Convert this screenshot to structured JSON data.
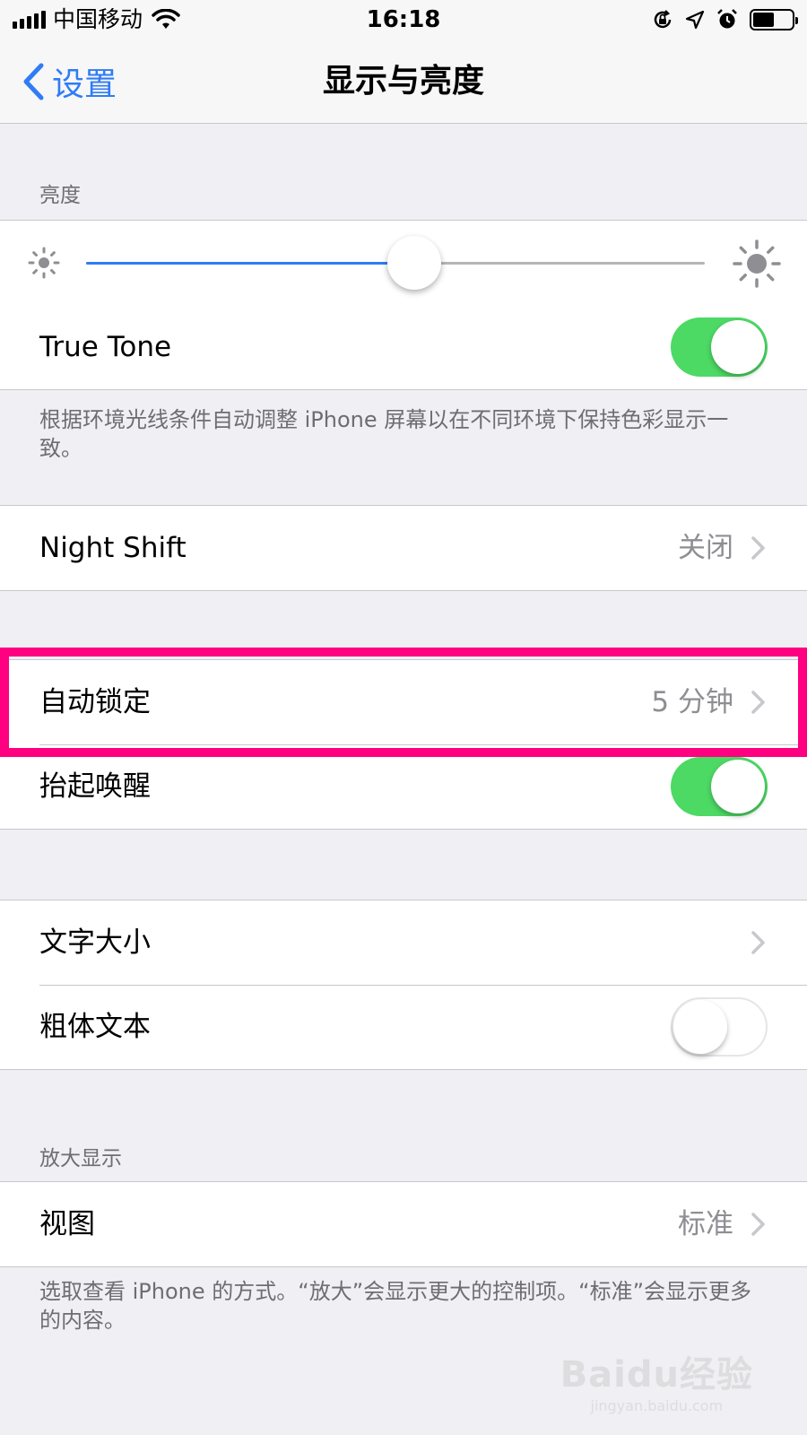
{
  "status_bar": {
    "carrier": "中国移动",
    "time": "16:18"
  },
  "nav": {
    "back_label": "设置",
    "title": "显示与亮度"
  },
  "brightness": {
    "header": "亮度",
    "level_percent": 53
  },
  "true_tone": {
    "label": "True Tone",
    "enabled": true,
    "footer": "根据环境光线条件自动调整 iPhone 屏幕以在不同环境下保持色彩显示一致。"
  },
  "night_shift": {
    "label": "Night Shift",
    "value": "关闭"
  },
  "auto_lock": {
    "label": "自动锁定",
    "value": "5 分钟"
  },
  "raise_to_wake": {
    "label": "抬起唤醒",
    "enabled": true
  },
  "text_size": {
    "label": "文字大小"
  },
  "bold_text": {
    "label": "粗体文本",
    "enabled": false
  },
  "zoom": {
    "header": "放大显示",
    "view_label": "视图",
    "view_value": "标准",
    "footer": "选取查看 iPhone 的方式。“放大”会显示更大的控制项。“标准”会显示更多的内容。"
  },
  "watermark": {
    "logo": "Baidu经验",
    "url": "jingyan.baidu.com"
  },
  "colors": {
    "accent": "#2f7cf6",
    "switch_on": "#4cd964",
    "highlight": "#ff0080"
  }
}
